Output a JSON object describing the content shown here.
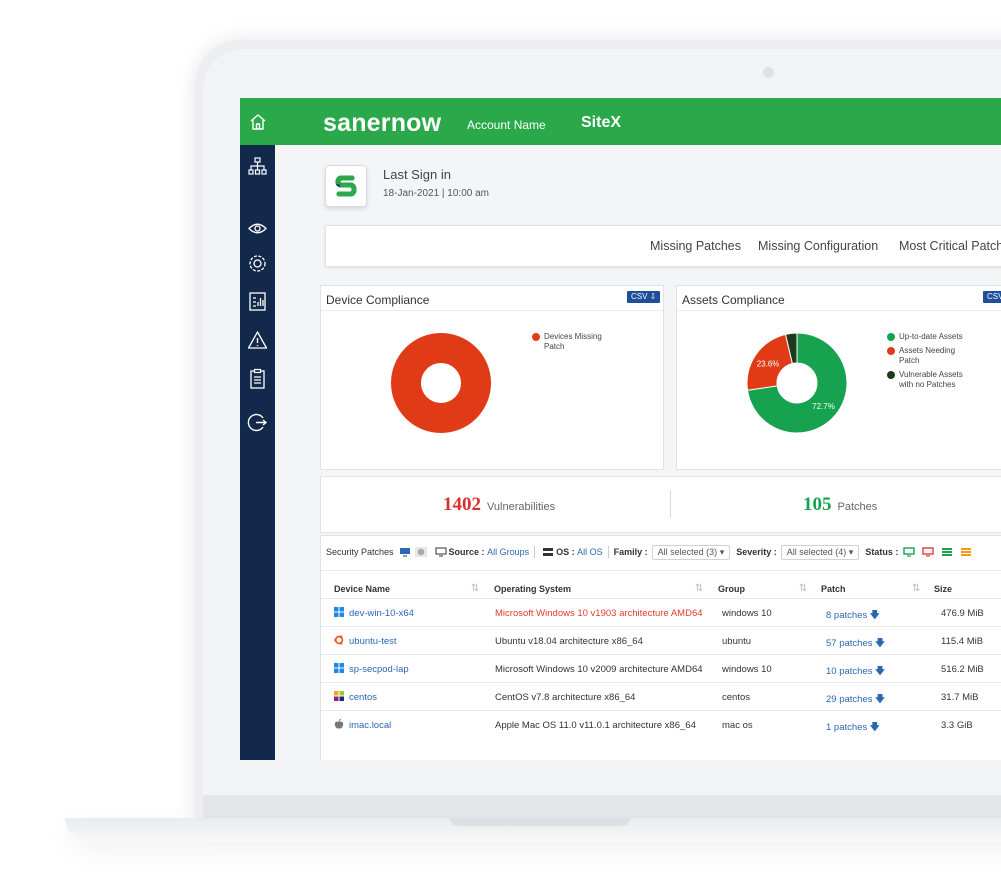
{
  "topbar": {
    "brand": "sanernow",
    "account_label": "Account Name",
    "account_value": "SiteX"
  },
  "signin": {
    "title": "Last Sign in",
    "date": "18-Jan-2021 | 10:00 am"
  },
  "tabs": [
    "Missing Patches",
    "Missing Configuration",
    "Most Critical Patch"
  ],
  "device_compliance": {
    "title": "Device Compliance",
    "csv": "CSV"
  },
  "assets_compliance": {
    "title": "Assets Compliance",
    "csv": "CSV"
  },
  "chart_data": [
    {
      "type": "pie",
      "title": "Device Compliance",
      "labels": [
        "Devices Missing Patch"
      ],
      "values": [
        100
      ],
      "colors": [
        "#e03b16"
      ]
    },
    {
      "type": "pie",
      "title": "Assets Compliance",
      "labels": [
        "Up-to-date Assets",
        "Assets Needing Patch",
        "Vulnerable Assets with no Patches"
      ],
      "values": [
        72.7,
        23.6,
        3.7
      ],
      "data_labels": [
        "72.7%",
        "23.6%",
        ""
      ],
      "colors": [
        "#17a24f",
        "#e03b16",
        "#1e3a1e"
      ]
    }
  ],
  "stats": {
    "vuln_count": "1402",
    "vuln_label": "Vulnerabilities",
    "patch_count": "105",
    "patch_label": "Patches"
  },
  "filters": {
    "title": "Security Patches",
    "source_label": "Source :",
    "source_value": "All Groups",
    "os_label": "OS :",
    "os_value": "All OS",
    "family_label": "Family :",
    "family_value": "All selected (3)",
    "severity_label": "Severity :",
    "severity_value": "All selected (4)",
    "status_label": "Status :"
  },
  "table": {
    "headers": [
      "Device Name",
      "Operating System",
      "Group",
      "Patch",
      "Size"
    ],
    "rows": [
      {
        "device": "dev-win-10-x64",
        "os": "Microsoft Windows 10 v1903 architecture AMD64",
        "group": "windows 10",
        "patch": "8 patches",
        "size": "476.9 MiB",
        "os_icon": "windows-icon"
      },
      {
        "device": "ubuntu-test",
        "os": "Ubuntu v18.04 architecture x86_64",
        "group": "ubuntu",
        "patch": "57 patches",
        "size": "115.4 MiB",
        "os_icon": "ubuntu-icon"
      },
      {
        "device": "sp-secpod-lap",
        "os": "Microsoft Windows 10 v2009 architecture AMD64",
        "group": "windows 10",
        "patch": "10 patches",
        "size": "516.2 MiB",
        "os_icon": "windows-icon"
      },
      {
        "device": "centos",
        "os": "CentOS v7.8 architecture x86_64",
        "group": "centos",
        "patch": "29 patches",
        "size": "31.7 MiB",
        "os_icon": "centos-icon"
      },
      {
        "device": "imac.local",
        "os": "Apple Mac OS 11.0 v11.0.1 architecture x86_64",
        "group": "mac os",
        "patch": "1 patches",
        "size": "3.3 GiB",
        "os_icon": "apple-icon"
      }
    ]
  },
  "colors": {
    "brand_green": "#2aa84a",
    "sidebar_navy": "#13294b",
    "link_blue": "#2b67b4",
    "danger_red": "#e03b2e",
    "success_green": "#17a24f"
  }
}
